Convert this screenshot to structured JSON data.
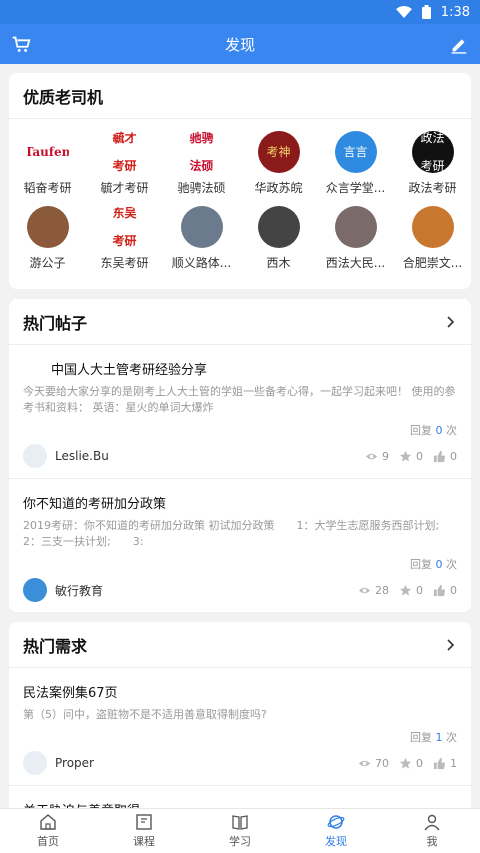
{
  "status": {
    "time": "1:38"
  },
  "appbar": {
    "title": "发现",
    "left_icon": "cart-icon",
    "right_icon": "edit-icon"
  },
  "drivers_section": {
    "title": "优质老司机",
    "items": [
      {
        "label": "韬奋考研",
        "badge": "Taufen",
        "bg": "#ffffff",
        "fg": "#c8102e"
      },
      {
        "label": "毓才考研",
        "badge": "毓才\n考研",
        "bg": "#ffffff",
        "fg": "#d0201a"
      },
      {
        "label": "驰骋法硕",
        "badge": "驰骋\n法硕",
        "bg": "#ffffff",
        "fg": "#c8102e"
      },
      {
        "label": "华政苏皖",
        "badge": "考神",
        "bg": "#8b1a1a",
        "fg": "#f5d36b"
      },
      {
        "label": "众言学堂...",
        "badge": "言言",
        "bg": "#2f8be0",
        "fg": "#ffffff"
      },
      {
        "label": "政法考研",
        "badge": "政法\n考研",
        "bg": "#111111",
        "fg": "#ffffff"
      },
      {
        "label": "游公子",
        "badge": "",
        "bg": "#8a5a3a",
        "fg": "#ffffff"
      },
      {
        "label": "东吴考研",
        "badge": "东吴\n考研",
        "bg": "#ffffff",
        "fg": "#d0201a"
      },
      {
        "label": "顺义路体...",
        "badge": "",
        "bg": "#6b7a8c",
        "fg": "#ffffff"
      },
      {
        "label": "西木",
        "badge": "",
        "bg": "#444444",
        "fg": "#ffffff"
      },
      {
        "label": "西法大民...",
        "badge": "",
        "bg": "#7a6a6a",
        "fg": "#ffffff"
      },
      {
        "label": "合肥崇文...",
        "badge": "",
        "bg": "#c8772e",
        "fg": "#ffffff"
      }
    ]
  },
  "hot_posts": {
    "title": "热门帖子",
    "posts": [
      {
        "title": "中国人大土管考研经验分享",
        "desc": "今天要给大家分享的是刚考上人大土管的学姐一些备考心得，一起学习起来吧！ 使用的参考书和资料： 英语：星火的单词大爆炸",
        "reply_prefix": "回复",
        "reply_count": "0",
        "reply_suffix": "次",
        "author": "Leslie.Bu",
        "views": "9",
        "stars": "0",
        "likes": "0"
      },
      {
        "title": "你不知道的考研加分政策",
        "desc": "2019考研：你不知道的考研加分政策 初试加分政策　　1：大学生志愿服务西部计划;　2：三支一扶计划;　　3:",
        "reply_prefix": "回复",
        "reply_count": "0",
        "reply_suffix": "次",
        "author": "敏行教育",
        "views": "28",
        "stars": "0",
        "likes": "0"
      }
    ]
  },
  "hot_demands": {
    "title": "热门需求",
    "posts": [
      {
        "title": "民法案例集67页",
        "desc": "第（5）问中，盗赃物不是不适用善意取得制度吗?",
        "reply_prefix": "回复",
        "reply_count": "1",
        "reply_suffix": "次",
        "author": "Proper",
        "views": "70",
        "stars": "0",
        "likes": "1"
      },
      {
        "title": "关于胁迫与善意取得",
        "desc": ""
      }
    ]
  },
  "tabs": [
    {
      "label": "首页",
      "icon": "home-icon"
    },
    {
      "label": "课程",
      "icon": "course-icon"
    },
    {
      "label": "学习",
      "icon": "book-icon"
    },
    {
      "label": "发现",
      "icon": "discover-icon",
      "active": true
    },
    {
      "label": "我",
      "icon": "user-icon"
    }
  ],
  "colors": {
    "primary": "#3a86f0",
    "link": "#2f7fe6"
  }
}
